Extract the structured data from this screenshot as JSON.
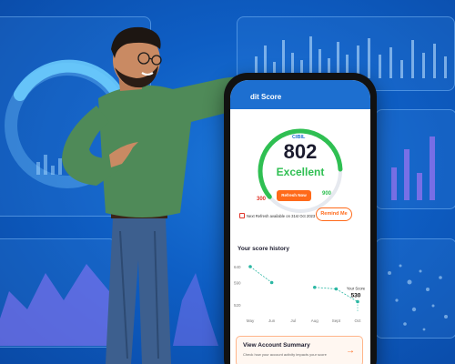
{
  "app": {
    "header_title": "dit Score",
    "bureau_label": "CIBIL",
    "score": "802",
    "rating": "Excellent",
    "score_min": "300",
    "score_max": "900",
    "score_fraction": 0.836,
    "refresh_button": "Refresh Now",
    "next_refresh": "Next Refresh available on 31st Oct 2023",
    "remind_button": "Remind Me",
    "history_title": "Your score history",
    "summary_title": "View Account Summary",
    "summary_subtitle": "Check how your account activity impacts your score",
    "colors": {
      "brand_blue": "#1d6fd0",
      "accent_orange": "#ff6a1a",
      "excellent_green": "#2fbf52",
      "low_red": "#e0362b"
    },
    "icons": [
      "calendar-icon",
      "arrow-right-icon"
    ]
  },
  "chart_data": {
    "type": "line",
    "categories": [
      "May",
      "Jun",
      "Jul",
      "Aug",
      "Sept",
      "Oct"
    ],
    "y_ticks": [
      "640",
      "590",
      "520"
    ],
    "series": [
      {
        "values": [
          640,
          590,
          null,
          575,
          570,
          530
        ]
      }
    ],
    "callout_label": "Your Score",
    "callout_value": "530",
    "ylim": [
      500,
      660
    ]
  }
}
